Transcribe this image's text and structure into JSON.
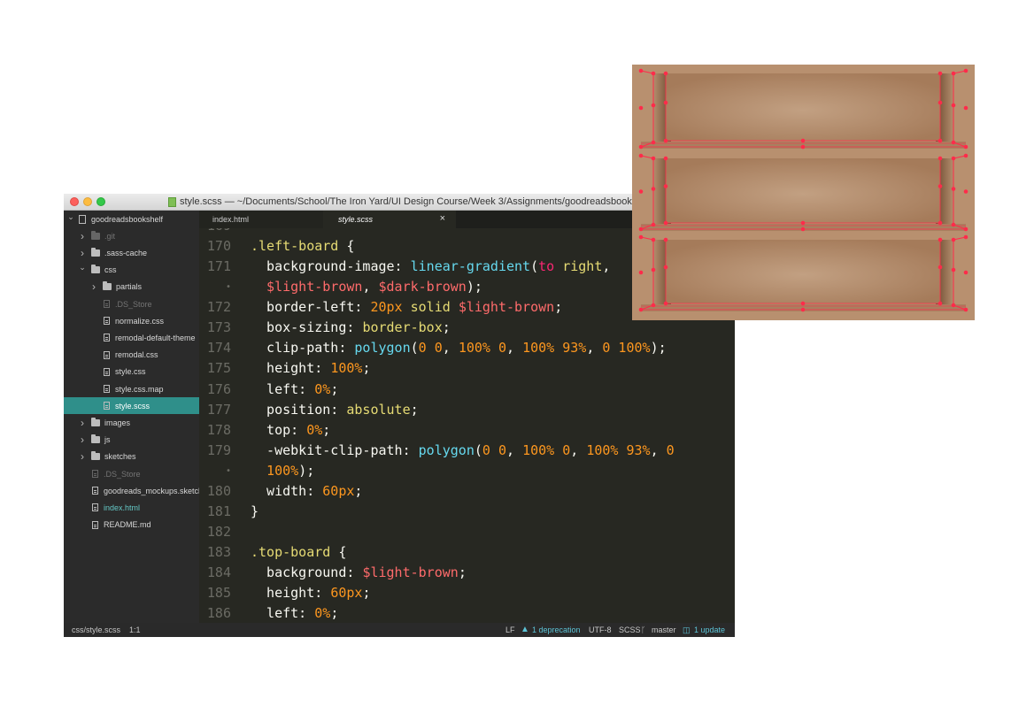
{
  "window": {
    "title": "style.scss — ~/Documents/School/The Iron Yard/UI Design Course/Week 3/Assignments/goodreadsbookshelf",
    "file_icon": "scss-file-icon"
  },
  "sidebar": {
    "items": [
      {
        "label": "goodreadsbookshelf",
        "indent": 0,
        "chevron": "down",
        "icon": "project",
        "state": "normal"
      },
      {
        "label": ".git",
        "indent": 1,
        "chevron": "right",
        "icon": "folder",
        "state": "dim"
      },
      {
        "label": ".sass-cache",
        "indent": 1,
        "chevron": "right",
        "icon": "folder",
        "state": "normal"
      },
      {
        "label": "css",
        "indent": 1,
        "chevron": "down",
        "icon": "folder",
        "state": "normal"
      },
      {
        "label": "partials",
        "indent": 2,
        "chevron": "right",
        "icon": "folder",
        "state": "normal"
      },
      {
        "label": ".DS_Store",
        "indent": 2,
        "chevron": "none",
        "icon": "file",
        "state": "dim"
      },
      {
        "label": "normalize.css",
        "indent": 2,
        "chevron": "none",
        "icon": "file",
        "state": "normal"
      },
      {
        "label": "remodal-default-theme",
        "indent": 2,
        "chevron": "none",
        "icon": "file",
        "state": "normal"
      },
      {
        "label": "remodal.css",
        "indent": 2,
        "chevron": "none",
        "icon": "file",
        "state": "normal"
      },
      {
        "label": "style.css",
        "indent": 2,
        "chevron": "none",
        "icon": "file",
        "state": "normal"
      },
      {
        "label": "style.css.map",
        "indent": 2,
        "chevron": "none",
        "icon": "file",
        "state": "normal"
      },
      {
        "label": "style.scss",
        "indent": 2,
        "chevron": "none",
        "icon": "file",
        "state": "selected"
      },
      {
        "label": "images",
        "indent": 1,
        "chevron": "right",
        "icon": "folder",
        "state": "normal"
      },
      {
        "label": "js",
        "indent": 1,
        "chevron": "right",
        "icon": "folder",
        "state": "normal"
      },
      {
        "label": "sketches",
        "indent": 1,
        "chevron": "right",
        "icon": "folder",
        "state": "normal"
      },
      {
        "label": ".DS_Store",
        "indent": 1,
        "chevron": "none",
        "icon": "file",
        "state": "dim"
      },
      {
        "label": "goodreads_mockups.sketch",
        "indent": 1,
        "chevron": "none",
        "icon": "file",
        "state": "normal"
      },
      {
        "label": "index.html",
        "indent": 1,
        "chevron": "none",
        "icon": "file",
        "state": "html"
      },
      {
        "label": "README.md",
        "indent": 1,
        "chevron": "none",
        "icon": "book",
        "state": "normal"
      }
    ]
  },
  "tabs": [
    {
      "label": "index.html",
      "active": false
    },
    {
      "label": "style.scss",
      "active": true,
      "close": "×"
    }
  ],
  "code_lines": [
    {
      "num": "169",
      "tokens": []
    },
    {
      "num": "170",
      "tokens": [
        {
          "t": ".left-board",
          "c": "sel"
        },
        {
          "t": " {",
          "c": "punc"
        }
      ]
    },
    {
      "num": "171",
      "tokens": [
        {
          "t": "  background-image: ",
          "c": "prop"
        },
        {
          "t": "linear-gradient",
          "c": "fn"
        },
        {
          "t": "(",
          "c": "punc"
        },
        {
          "t": "to",
          "c": "kw"
        },
        {
          "t": " right",
          "c": "val"
        },
        {
          "t": ",",
          "c": "punc"
        }
      ]
    },
    {
      "num": "•",
      "tokens": [
        {
          "t": "  $light-brown",
          "c": "var"
        },
        {
          "t": ", ",
          "c": "punc"
        },
        {
          "t": "$dark-brown",
          "c": "var"
        },
        {
          "t": ");",
          "c": "punc"
        }
      ]
    },
    {
      "num": "172",
      "tokens": [
        {
          "t": "  border-left: ",
          "c": "prop"
        },
        {
          "t": "20px",
          "c": "num"
        },
        {
          "t": " solid ",
          "c": "val"
        },
        {
          "t": "$light-brown",
          "c": "var"
        },
        {
          "t": ";",
          "c": "punc"
        }
      ]
    },
    {
      "num": "173",
      "tokens": [
        {
          "t": "  box-sizing: ",
          "c": "prop"
        },
        {
          "t": "border-box",
          "c": "val"
        },
        {
          "t": ";",
          "c": "punc"
        }
      ]
    },
    {
      "num": "174",
      "tokens": [
        {
          "t": "  clip-path: ",
          "c": "prop"
        },
        {
          "t": "polygon",
          "c": "fn"
        },
        {
          "t": "(",
          "c": "punc"
        },
        {
          "t": "0 0",
          "c": "num"
        },
        {
          "t": ", ",
          "c": "punc"
        },
        {
          "t": "100% 0",
          "c": "num"
        },
        {
          "t": ", ",
          "c": "punc"
        },
        {
          "t": "100% 93%",
          "c": "num"
        },
        {
          "t": ", ",
          "c": "punc"
        },
        {
          "t": "0 100%",
          "c": "num"
        },
        {
          "t": ");",
          "c": "punc"
        }
      ]
    },
    {
      "num": "175",
      "tokens": [
        {
          "t": "  height: ",
          "c": "prop"
        },
        {
          "t": "100%",
          "c": "num"
        },
        {
          "t": ";",
          "c": "punc"
        }
      ]
    },
    {
      "num": "176",
      "tokens": [
        {
          "t": "  left: ",
          "c": "prop"
        },
        {
          "t": "0%",
          "c": "num"
        },
        {
          "t": ";",
          "c": "punc"
        }
      ]
    },
    {
      "num": "177",
      "tokens": [
        {
          "t": "  position: ",
          "c": "prop"
        },
        {
          "t": "absolute",
          "c": "val"
        },
        {
          "t": ";",
          "c": "punc"
        }
      ]
    },
    {
      "num": "178",
      "tokens": [
        {
          "t": "  top: ",
          "c": "prop"
        },
        {
          "t": "0%",
          "c": "num"
        },
        {
          "t": ";",
          "c": "punc"
        }
      ]
    },
    {
      "num": "179",
      "tokens": [
        {
          "t": "  -webkit-clip-path: ",
          "c": "prop"
        },
        {
          "t": "polygon",
          "c": "fn"
        },
        {
          "t": "(",
          "c": "punc"
        },
        {
          "t": "0 0",
          "c": "num"
        },
        {
          "t": ", ",
          "c": "punc"
        },
        {
          "t": "100% 0",
          "c": "num"
        },
        {
          "t": ", ",
          "c": "punc"
        },
        {
          "t": "100% 93%",
          "c": "num"
        },
        {
          "t": ", ",
          "c": "punc"
        },
        {
          "t": "0",
          "c": "num"
        }
      ]
    },
    {
      "num": "•",
      "tokens": [
        {
          "t": "  100%",
          "c": "num"
        },
        {
          "t": ");",
          "c": "punc"
        }
      ]
    },
    {
      "num": "180",
      "tokens": [
        {
          "t": "  width: ",
          "c": "prop"
        },
        {
          "t": "60px",
          "c": "num"
        },
        {
          "t": ";",
          "c": "punc"
        }
      ]
    },
    {
      "num": "181",
      "tokens": [
        {
          "t": "}",
          "c": "punc"
        }
      ]
    },
    {
      "num": "182",
      "tokens": []
    },
    {
      "num": "183",
      "tokens": [
        {
          "t": ".top-board",
          "c": "sel"
        },
        {
          "t": " {",
          "c": "punc"
        }
      ]
    },
    {
      "num": "184",
      "tokens": [
        {
          "t": "  background: ",
          "c": "prop"
        },
        {
          "t": "$light-brown",
          "c": "var"
        },
        {
          "t": ";",
          "c": "punc"
        }
      ]
    },
    {
      "num": "185",
      "tokens": [
        {
          "t": "  height: ",
          "c": "prop"
        },
        {
          "t": "60px",
          "c": "num"
        },
        {
          "t": ";",
          "c": "punc"
        }
      ]
    },
    {
      "num": "186",
      "tokens": [
        {
          "t": "  left: ",
          "c": "prop"
        },
        {
          "t": "0%",
          "c": "num"
        },
        {
          "t": ";",
          "c": "punc"
        }
      ]
    }
  ],
  "statusbar": {
    "path": "css/style.scss",
    "position": "1:1",
    "line_ending": "LF",
    "warning_icon": "warning-icon",
    "warning": "1 deprecation",
    "encoding": "UTF-8",
    "syntax": "SCSS",
    "branch_icon": "git-branch-icon",
    "branch": "master",
    "update_icon": "package-icon",
    "update": "1 update"
  },
  "colors": {
    "editor_bg": "#272822",
    "sidebar_bg": "#2b2b2b",
    "selection": "#2f8f8a",
    "accent": "#5cc3d6",
    "shelf_wood": "#b8906f",
    "shelf_marker": "#ff2b4a"
  }
}
